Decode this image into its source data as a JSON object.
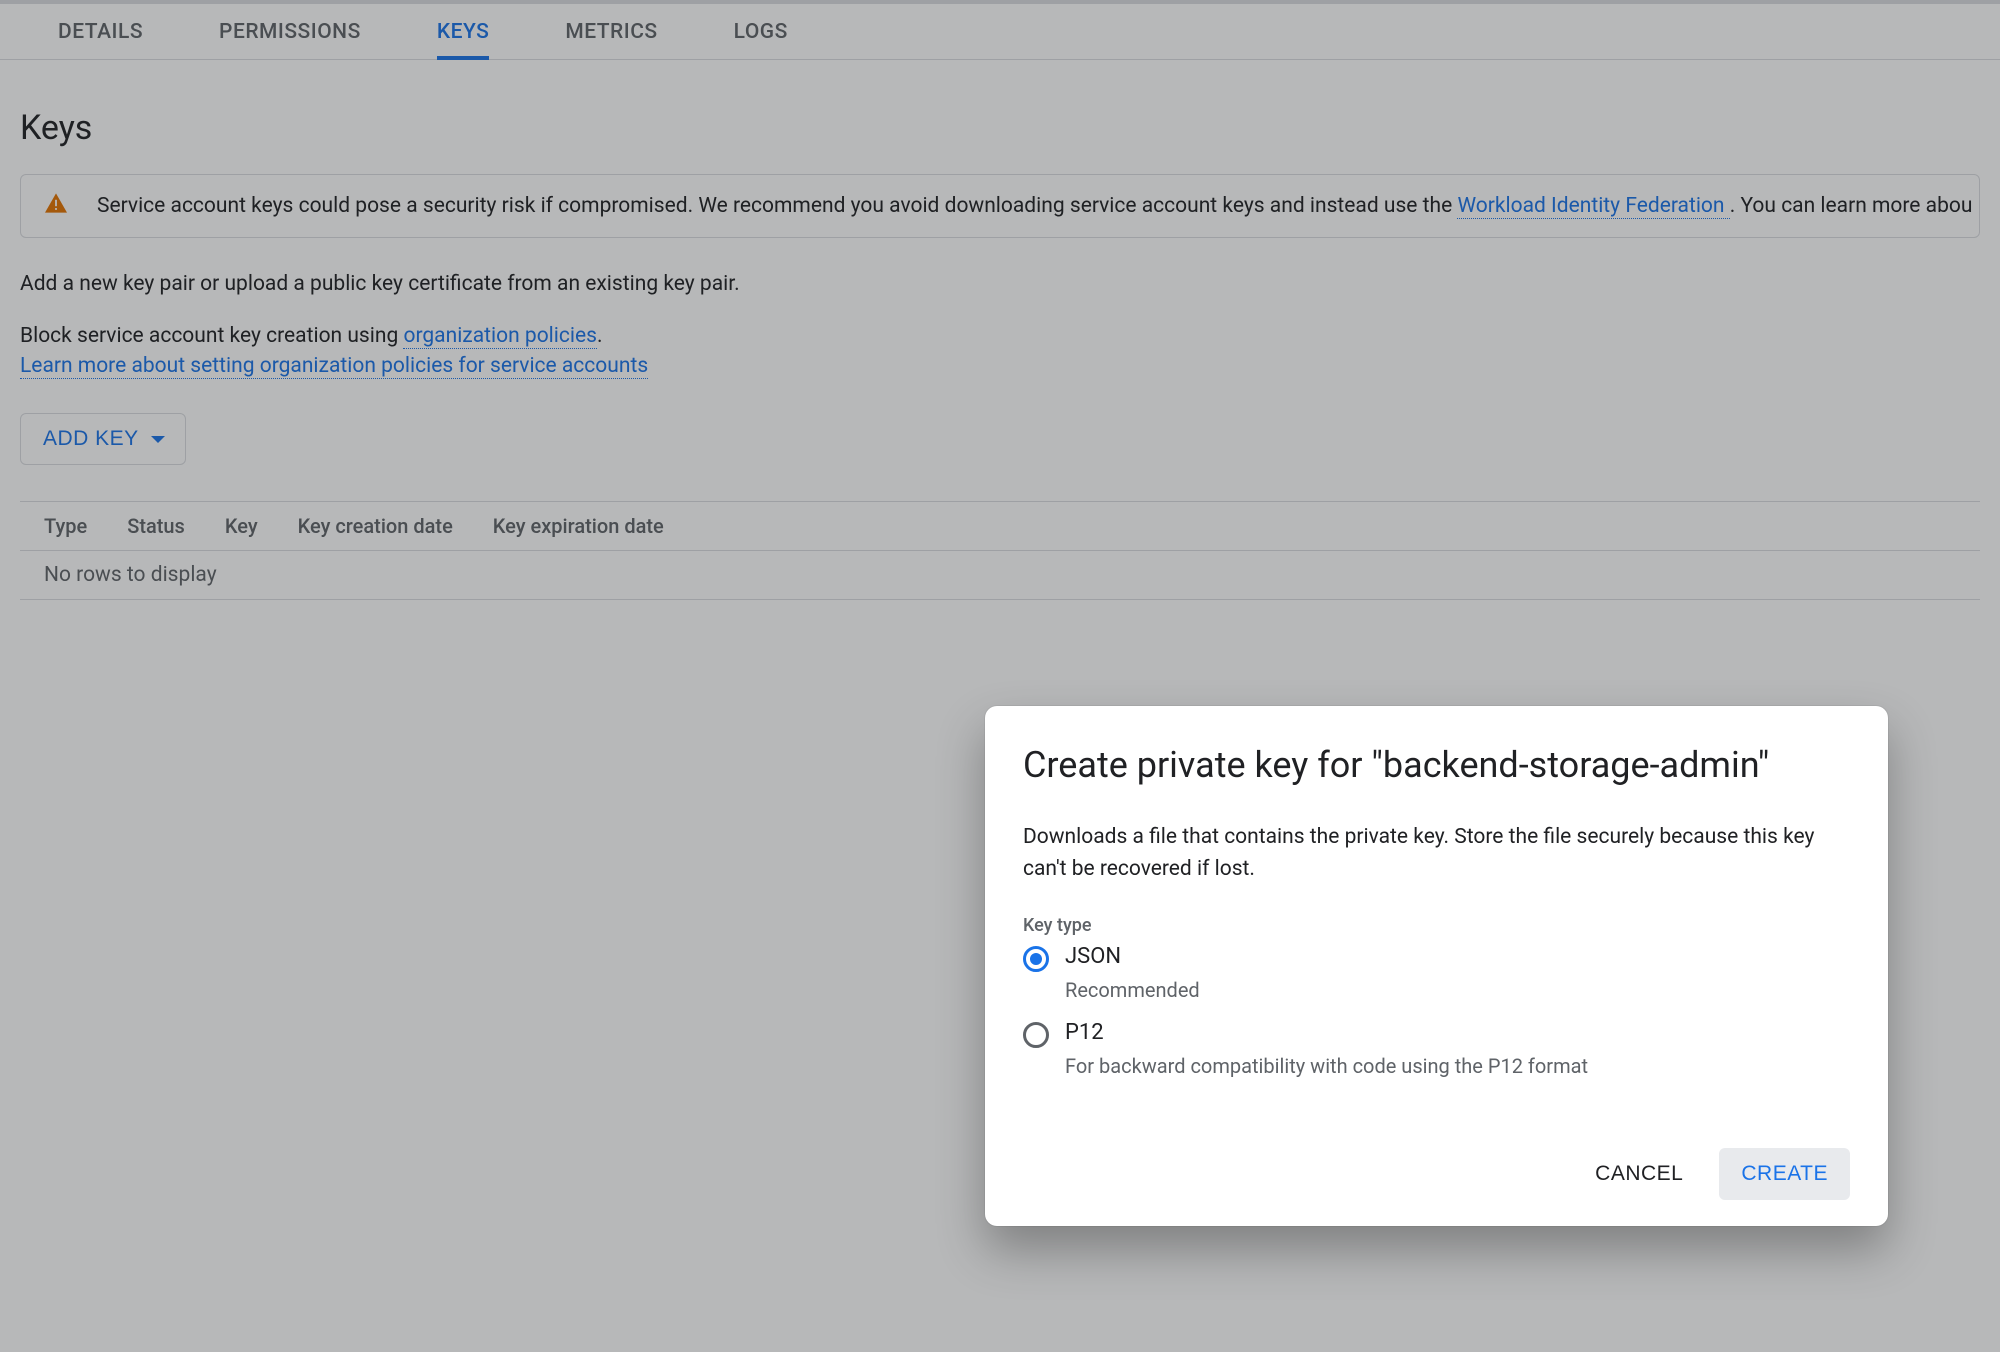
{
  "tabs": {
    "details": "DETAILS",
    "permissions": "PERMISSIONS",
    "keys": "KEYS",
    "metrics": "METRICS",
    "logs": "LOGS",
    "active": "keys"
  },
  "page": {
    "title": "Keys"
  },
  "banner": {
    "text_before": "Service account keys could pose a security risk if compromised. We recommend you avoid downloading service account keys and instead use the ",
    "link": "Workload Identity Federation ",
    "text_after": ". You can learn more abou"
  },
  "body": {
    "p1": "Add a new key pair or upload a public key certificate from an existing key pair.",
    "p2_before": "Block service account key creation using ",
    "p2_link": "organization policies",
    "p2_after": ".",
    "p3_link": "Learn more about setting organization policies for service accounts",
    "add_key": "ADD KEY"
  },
  "table": {
    "cols": [
      "Type",
      "Status",
      "Key",
      "Key creation date",
      "Key expiration date"
    ],
    "empty": "No rows to display"
  },
  "dialog": {
    "title": "Create private key for \"backend-storage-admin\"",
    "desc": "Downloads a file that contains the private key. Store the file securely because this key can't be recovered if lost.",
    "key_type_label": "Key type",
    "options": [
      {
        "label": "JSON",
        "sub": "Recommended",
        "checked": true
      },
      {
        "label": "P12",
        "sub": "For backward compatibility with code using the P12 format",
        "checked": false
      }
    ],
    "cancel": "CANCEL",
    "create": "CREATE"
  }
}
